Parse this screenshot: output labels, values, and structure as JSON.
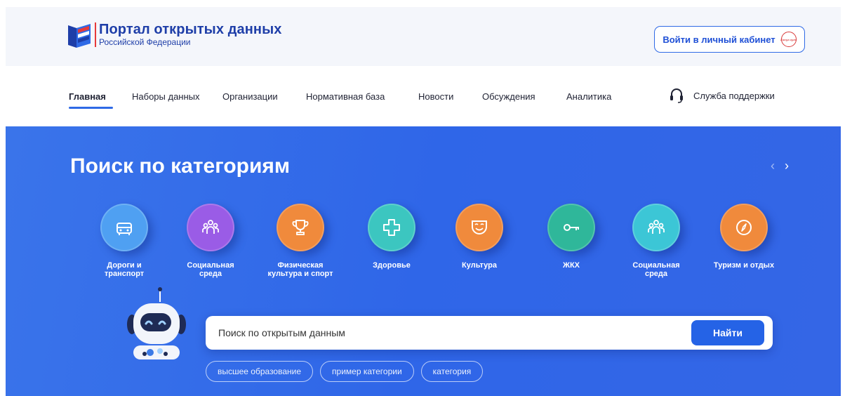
{
  "header": {
    "logo": {
      "title": "Портал открытых данных",
      "subtitle": "Российской Федерации"
    },
    "login_button": {
      "label": "Войти в личный кабинет",
      "badge": "Госуслуги"
    }
  },
  "nav": {
    "items": [
      {
        "label": "Главная",
        "active": true
      },
      {
        "label": "Наборы данных"
      },
      {
        "label": "Организации"
      },
      {
        "label": "Нормативная база"
      },
      {
        "label": "Новости"
      },
      {
        "label": "Обсуждения"
      },
      {
        "label": "Аналитика"
      }
    ],
    "support": {
      "label": "Служба поддержки",
      "icon": "headset-icon"
    }
  },
  "hero": {
    "title": "Поиск по категориям",
    "arrows": {
      "prev": "‹",
      "next": "›"
    },
    "categories": [
      {
        "label": "Дороги и\nтранспорт",
        "icon": "car-icon",
        "color": "#4fa0f2"
      },
      {
        "label": "Социальная\nсреда",
        "icon": "people-icon",
        "color": "#9a5ce6"
      },
      {
        "label": "Физическая\nкультура и спорт",
        "icon": "trophy-icon",
        "color": "#f08a3c"
      },
      {
        "label": "Здоровье",
        "icon": "medical-cross-icon",
        "color": "#3cc6c0"
      },
      {
        "label": "Культура",
        "icon": "theater-mask-icon",
        "color": "#f08a3c"
      },
      {
        "label": "ЖКХ",
        "icon": "key-icon",
        "color": "#2fb79a"
      },
      {
        "label": "Социальная\nсреда",
        "icon": "people-icon",
        "color": "#3cc6d6"
      },
      {
        "label": "Туризм и отдых",
        "icon": "compass-icon",
        "color": "#f08a3c"
      }
    ],
    "search": {
      "placeholder": "Поиск по открытым данным",
      "button_label": "Найти"
    },
    "chips": [
      "высшее образование",
      "пример категории",
      "категория"
    ]
  },
  "colors": {
    "accent": "#2f6ae6",
    "hero_bg": "#3466e6",
    "logo_red": "#e63a3a"
  }
}
